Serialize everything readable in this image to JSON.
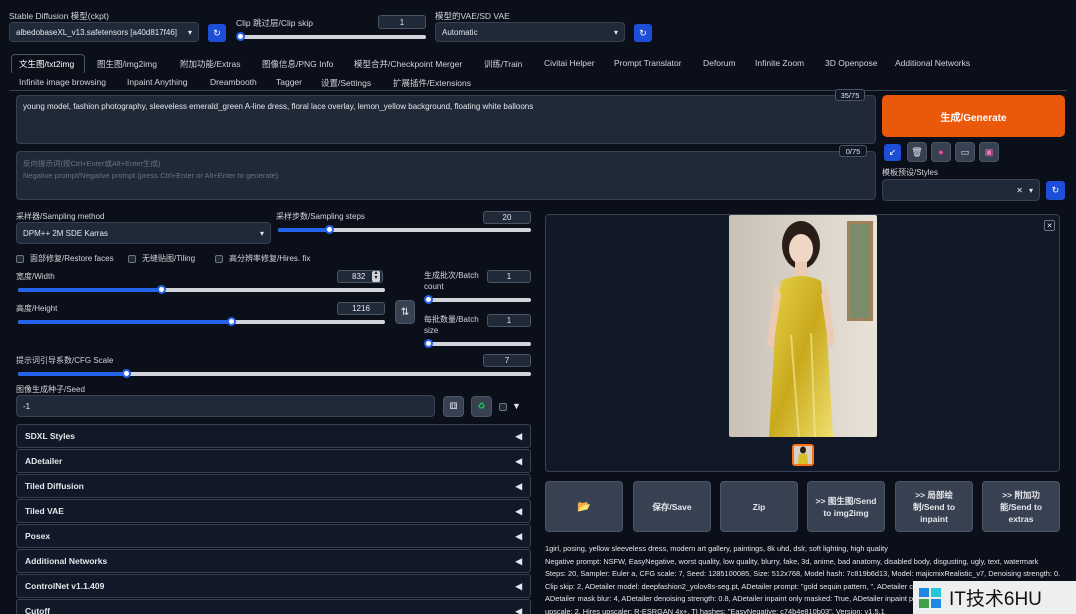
{
  "top": {
    "ckpt_label": "Stable Diffusion 模型(ckpt)",
    "ckpt_value": "albedobaseXL_v13.safetensors [a40d817f46]",
    "clip_label": "Clip 跳过层/Clip skip",
    "clip_value": "1",
    "vae_label": "模型的VAE/SD VAE",
    "vae_value": "Automatic"
  },
  "tabs_row1": [
    "文生图/txt2img",
    "图生图/img2img",
    "附加功能/Extras",
    "图像信息/PNG Info",
    "模型合并/Checkpoint Merger",
    "训练/Train",
    "Civitai Helper",
    "Prompt Translator",
    "Deforum",
    "Infinite Zoom",
    "3D Openpose",
    "Additional Networks"
  ],
  "tabs_row2": [
    "Infinite image browsing",
    "Inpaint Anything",
    "Dreambooth",
    "Tagger",
    "设置/Settings",
    "扩展插件/Extensions"
  ],
  "prompt": {
    "text": "young model, fashion photography, sleeveless emerald_green A-line dress, floral lace overlay, lemon_yellow background, floating white balloons",
    "count": "35/75",
    "neg_placeholder_1": "反向提示词(按Ctrl+Enter或Alt+Enter生成)",
    "neg_placeholder_2": "Negative prompt/Negative prompt (press Ctrl+Enter or Alt+Enter to generate)",
    "neg_count": "0/75"
  },
  "generate_label": "生成/Generate",
  "styles_label": "模板预设/Styles",
  "sampling": {
    "method_label": "采样器/Sampling method",
    "method_value": "DPM++ 2M SDE Karras",
    "steps_label": "采样步数/Sampling steps",
    "steps_value": "20",
    "steps_frac": 0.2
  },
  "checks": {
    "restore": "面部修复/Restore faces",
    "tiling": "无缝贴图/Tiling",
    "hires": "高分辨率修复/Hires. fix"
  },
  "size": {
    "width_label": "宽度/Width",
    "width_value": "832",
    "width_frac": 0.39,
    "height_label": "高度/Height",
    "height_value": "1216",
    "height_frac": 0.58,
    "batch_count_label": "生成批次/Batch count",
    "batch_count_value": "1",
    "batch_size_label": "每批数量/Batch size",
    "batch_size_value": "1"
  },
  "cfg": {
    "label": "提示词引导系数/CFG Scale",
    "value": "7",
    "frac": 0.21
  },
  "seed": {
    "label": "图像生成种子/Seed",
    "value": "-1"
  },
  "accordions": [
    "SDXL Styles",
    "ADetailer",
    "Tiled Diffusion",
    "Tiled VAE",
    "Posex",
    "Additional Networks",
    "ControlNet v1.1.409",
    "Cutoff"
  ],
  "output_buttons": {
    "folder": "📂",
    "save": "保存/Save",
    "zip": "Zip",
    "send_img2img": ">> 图生图/Send to img2img",
    "send_inpaint": ">> 局部绘制/Send to inpaint",
    "send_extras": ">> 附加功能/Send to extras"
  },
  "info": {
    "line1": "1girl, posing, yellow sleeveless dress, modern art gallery, paintings, 8k uhd, dslr, soft lighting, high quality",
    "line2": "Negative prompt: NSFW, EasyNegative, worst quality, low quality, blurry, fake, 3d, anime, bad anatomy, disabled body, disgusting, ugly, text, watermark",
    "line3": "Steps: 20, Sampler: Euler a, CFG scale: 7, Seed: 1285100085, Size: 512x768, Model hash: 7c819b6d13, Model: majicmixRealistic_v7, Denoising strength: 0.3,",
    "line4": "Clip skip: 2, ADetailer model: deepfashion2_yolov8s-seg.pt, ADetailer prompt: \"gold sequin pattern, \", ADetailer c",
    "line5": "ADetailer mask blur: 4, ADetailer denoising strength: 0.8, ADetailer inpaint only masked: True, ADetailer inpaint p",
    "line6": "upscale: 2, Hires upscaler: R-ESRGAN 4x+, TI hashes: \"EasyNegative: c74b4e810b03\", Version: v1.5.1"
  },
  "watermark": "IT技术6HU"
}
